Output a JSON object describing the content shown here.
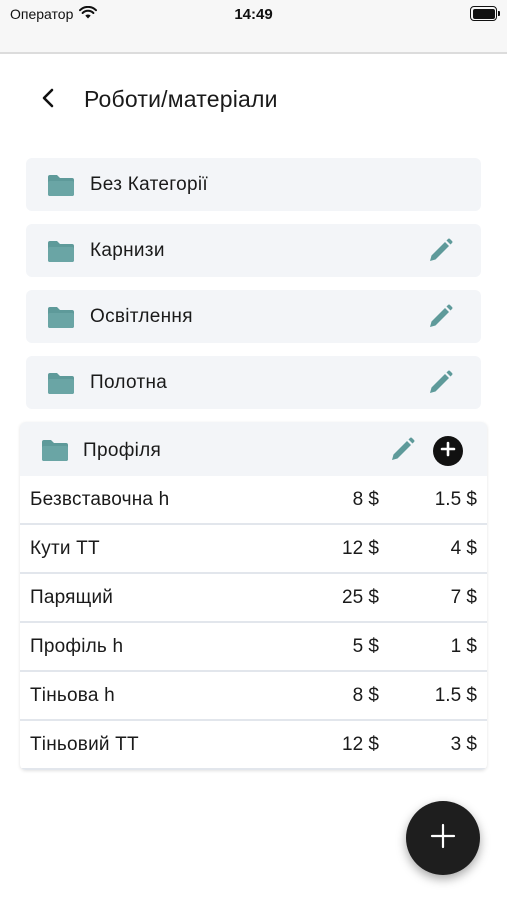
{
  "status_bar": {
    "carrier": "Оператор",
    "time": "14:49",
    "icons": [
      "wifi-icon",
      "battery-icon"
    ]
  },
  "header": {
    "title": "Роботи/матеріали",
    "back_icon": "chevron-left-icon"
  },
  "colors": {
    "accent": "#5e9a9a",
    "row_background": "#f3f5f8",
    "fab": "#1e1e1e"
  },
  "categories": [
    {
      "label": "Без Категорії",
      "icon": "folder-icon",
      "editable": false
    },
    {
      "label": "Карнизи",
      "icon": "folder-icon",
      "editable": true
    },
    {
      "label": "Освітлення",
      "icon": "folder-icon",
      "editable": true
    },
    {
      "label": "Полотна",
      "icon": "folder-icon",
      "editable": true
    }
  ],
  "expanded_category": {
    "label": "Профіля",
    "icon": "folder-icon",
    "actions": [
      "edit-icon",
      "add-icon"
    ],
    "items": [
      {
        "name": "Безвставочна h",
        "price": "8 $",
        "cost": "1.5 $"
      },
      {
        "name": "Кути ТТ",
        "price": "12 $",
        "cost": "4 $"
      },
      {
        "name": "Парящий",
        "price": "25 $",
        "cost": "7 $"
      },
      {
        "name": "Профіль h",
        "price": "5 $",
        "cost": "1 $"
      },
      {
        "name": "Тіньова h",
        "price": "8 $",
        "cost": "1.5 $"
      },
      {
        "name": "Тіньовий ТТ",
        "price": "12 $",
        "cost": "3 $"
      }
    ]
  },
  "fab": {
    "icon": "plus-icon"
  }
}
